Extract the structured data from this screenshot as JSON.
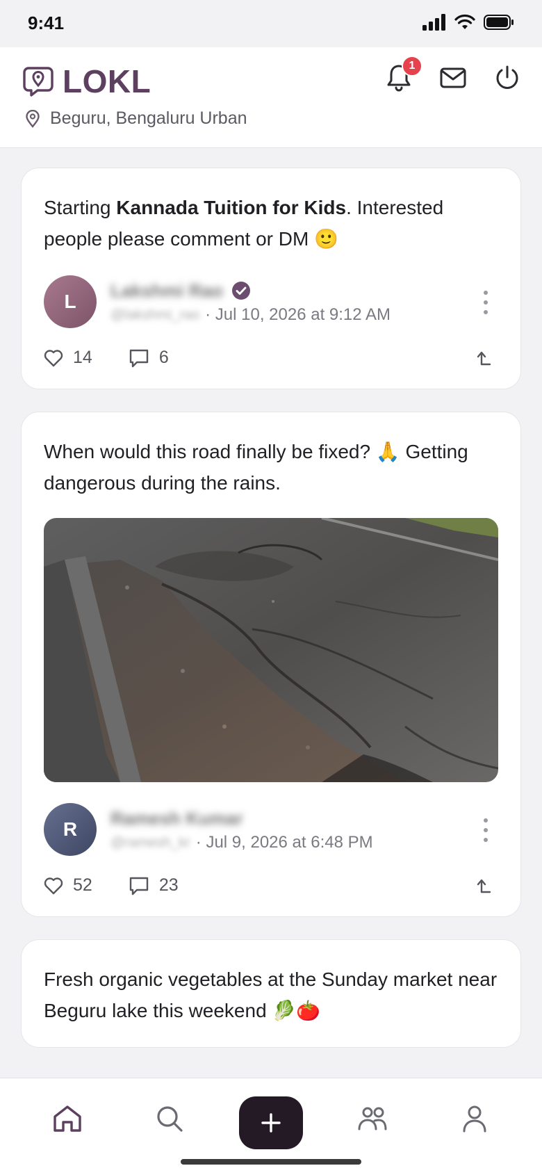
{
  "status_bar": {
    "time": "9:41"
  },
  "header": {
    "app_name": "LOKL",
    "location": "Beguru, Bengaluru Urban",
    "notification_count": "1",
    "brand_color": "#5d3f5f"
  },
  "posts": [
    {
      "text_before": "Starting ",
      "text_bold": "Kannada Tuition for Kids",
      "text_after": ". Interested people please comment or DM 🙂",
      "author_initial": "L",
      "author_name": "Lakshmi Rao",
      "author_handle": "@lakshmi_rao",
      "verified": true,
      "timestamp": "· Jul 10, 2026 at 9:12 AM",
      "likes": "14",
      "comments": "6"
    },
    {
      "text": "When would this road finally be fixed? 🙏 Getting dangerous during the rains.",
      "image": "pothole-road-photo",
      "author_initial": "R",
      "author_name": "Ramesh Kumar",
      "author_handle": "@ramesh_kr",
      "timestamp": "· Jul 9, 2026 at 6:48 PM",
      "likes": "52",
      "comments": "23"
    },
    {
      "text": "Fresh organic vegetables at the Sunday market near Beguru lake this weekend 🥬🍅"
    }
  ],
  "bottom_nav": {
    "items": [
      "home-icon",
      "search-icon",
      "create-post-icon",
      "community-icon",
      "profile-icon"
    ]
  }
}
